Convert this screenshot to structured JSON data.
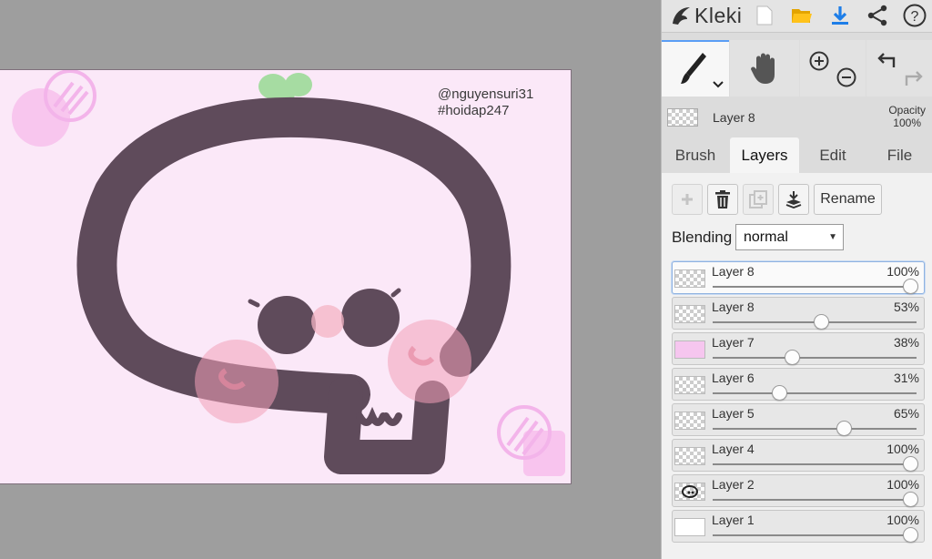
{
  "app": {
    "logo_text": "Kleki"
  },
  "canvas": {
    "watermark_line1": "@nguyensuri31",
    "watermark_line2": "#hoidap247",
    "background_color": "#fbe8f8",
    "ink_color": "#5f4b5b"
  },
  "toolbar": {
    "icons": [
      "new-file-icon",
      "open-folder-icon",
      "download-icon",
      "share-icon",
      "help-icon"
    ]
  },
  "tools": {
    "brush": "brush-tool",
    "hand": "hand-tool",
    "zoom_in": "zoom-in",
    "zoom_out": "zoom-out",
    "undo": "undo",
    "redo": "redo"
  },
  "current_layer": {
    "name": "Layer 8",
    "opacity_label": "Opacity",
    "opacity_value": "100%"
  },
  "tabs": [
    {
      "label": "Brush",
      "active": false
    },
    {
      "label": "Layers",
      "active": true
    },
    {
      "label": "Edit",
      "active": false
    },
    {
      "label": "File",
      "active": false
    }
  ],
  "layer_actions": {
    "rename_label": "Rename"
  },
  "blending": {
    "label": "Blending",
    "value": "normal"
  },
  "layers": [
    {
      "name": "Layer 8",
      "opacity": "100%",
      "value": 1.0,
      "thumb": "checker",
      "selected": true
    },
    {
      "name": "Layer 8",
      "opacity": "53%",
      "value": 0.53,
      "thumb": "checker",
      "selected": false
    },
    {
      "name": "Layer 7",
      "opacity": "38%",
      "value": 0.38,
      "thumb": "pink",
      "selected": false
    },
    {
      "name": "Layer 6",
      "opacity": "31%",
      "value": 0.31,
      "thumb": "checker",
      "selected": false
    },
    {
      "name": "Layer 5",
      "opacity": "65%",
      "value": 0.65,
      "thumb": "checker",
      "selected": false
    },
    {
      "name": "Layer 4",
      "opacity": "100%",
      "value": 1.0,
      "thumb": "checker",
      "selected": false
    },
    {
      "name": "Layer 2",
      "opacity": "100%",
      "value": 1.0,
      "thumb": "drawing",
      "selected": false
    },
    {
      "name": "Layer 1",
      "opacity": "100%",
      "value": 1.0,
      "thumb": "white",
      "selected": false
    }
  ],
  "colors": {
    "accent": "#1e7ee8",
    "pink_thumb": "#f6c6ef",
    "sprout": "#a6dca2",
    "blush": "#f3a0b8"
  }
}
